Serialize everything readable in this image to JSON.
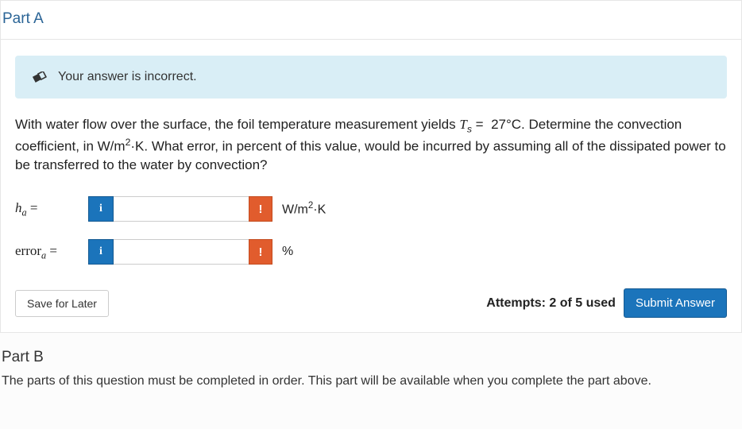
{
  "partA": {
    "title": "Part A",
    "alert": {
      "message": "Your answer is incorrect."
    },
    "question": {
      "text_before": "With water flow over the surface, the foil temperature measurement yields ",
      "var": "T",
      "sub": "s",
      "eq": " = ",
      "temp": "27°C",
      "text_after1": ". Determine the convection coefficient, in W/m",
      "sup2": "2",
      "text_after2": "·K. What error, in percent of this value, would be incurred by assuming all of the dissipated power to be transferred to the water by convection?"
    },
    "rows": [
      {
        "label_var": "h",
        "label_sub": "a",
        "label_eq": " =",
        "info": "i",
        "err": "!",
        "unit_html": "W/m<sup>2</sup>·K",
        "value": ""
      },
      {
        "label_prefix": "error",
        "label_sub": "a",
        "label_eq": " =",
        "info": "i",
        "err": "!",
        "unit_html": "%",
        "value": ""
      }
    ],
    "save_label": "Save for Later",
    "attempts": "Attempts: 2 of 5 used",
    "submit_label": "Submit Answer"
  },
  "partB": {
    "title": "Part B",
    "message": "The parts of this question must be completed in order. This part will be available when you complete the part above."
  }
}
